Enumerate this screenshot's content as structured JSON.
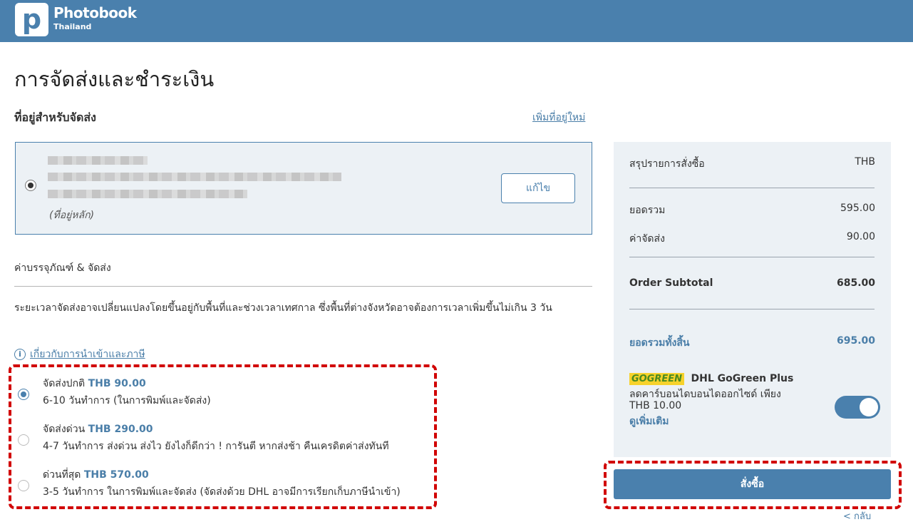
{
  "header": {
    "logo_letter": "p",
    "brand": "Photobook",
    "brand_sub": "Thailand"
  },
  "page": {
    "title": "การจัดส่งและชำระเงิน"
  },
  "address": {
    "heading": "ที่อยู่สำหรับจัดส่ง",
    "add_link": "เพิ่มที่อยู่ใหม่",
    "primary_label": "(ที่อยู่หลัก)",
    "edit_button": "แก้ไข",
    "selected": true
  },
  "shipping": {
    "heading": "ค่าบรรจุภัณฑ์ & จัดส่ง",
    "note": "ระยะเวลาจัดส่งอาจเปลี่ยนแปลงโดยขึ้นอยู่กับพื้นที่และช่วงเวลาเทศกาล ซึ่งพื้นที่ต่างจังหวัดอาจต้องการเวลาเพิ่มขึ้นไม่เกิน 3 วัน",
    "import_link": "เกี่ยวกับการนำเข้าและภาษี",
    "info_icon": "i",
    "options": [
      {
        "label": "จัดส่งปกติ",
        "price": "THB 90.00",
        "desc": "6-10 วันทำการ (ในการพิมพ์และจัดส่ง)",
        "selected": true
      },
      {
        "label": "จัดส่งด่วน",
        "price": "THB 290.00",
        "desc": "4-7 วันทำการ ส่งด่วน ส่งไว ยังไงก็ดีกว่า ! การันตี หากส่งช้า คืนเครดิตค่าส่งทันที",
        "selected": false
      },
      {
        "label": "ด่วนที่สุด",
        "price": "THB 570.00",
        "desc": "3-5 วันทำการ ในการพิมพ์และจัดส่ง (จัดส่งด้วย DHL อาจมีการเรียกเก็บภาษีนำเข้า)",
        "selected": false
      }
    ]
  },
  "summary": {
    "title": "สรุปรายการสั่งซื้อ",
    "currency": "THB",
    "subtotal_label": "ยอดรวม",
    "subtotal_value": "595.00",
    "shipping_label": "ค่าจัดส่ง",
    "shipping_value": "90.00",
    "order_subtotal_label": "Order Subtotal",
    "order_subtotal_value": "685.00",
    "grand_total_label": "ยอดรวมทั้งสิ้น",
    "grand_total_value": "695.00",
    "gogreen_badge": "GOGREEN",
    "gogreen_title": "DHL GoGreen Plus",
    "gogreen_desc": "ลดคาร์บอนไดบอนไดออกไซด์ เพียง",
    "gogreen_price": "THB 10.00",
    "gogreen_more": "ดูเพิ่มเติม",
    "gogreen_enabled": true
  },
  "actions": {
    "order_button": "สั่งซื้อ",
    "back_link": "< กลับ"
  },
  "colors": {
    "brand": "#4a80ad",
    "link": "#4a7ea8",
    "highlight_dash": "#d10000",
    "panel_bg": "#ecf1f5"
  }
}
